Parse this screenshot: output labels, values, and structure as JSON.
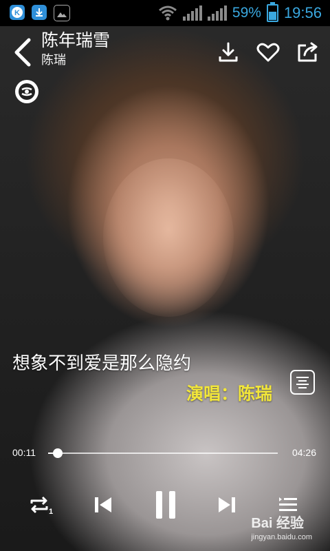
{
  "status_bar": {
    "battery_percent": "59%",
    "time": "19:56",
    "icons": [
      "kugou-app-icon",
      "download-notification-icon",
      "image-notification-icon",
      "wifi-icon",
      "signal-icon",
      "signal-icon",
      "battery-icon"
    ]
  },
  "header": {
    "song_title": "陈年瑞雪",
    "artist": "陈瑞",
    "icons": [
      "back-icon",
      "download-icon",
      "heart-icon",
      "share-icon"
    ]
  },
  "mode_icon": "sound-effect-icon",
  "lyrics": {
    "current_line": "想象不到爱是那么隐约",
    "singer_line": "演唱：陈瑞"
  },
  "progress": {
    "current_time": "00:11",
    "total_time": "04:26",
    "fraction": 0.041
  },
  "controls": {
    "icons": [
      "repeat-one-icon",
      "previous-icon",
      "pause-icon",
      "next-icon",
      "playlist-icon"
    ]
  },
  "watermark": {
    "brand": "Bai 经验",
    "url": "jingyan.baidu.com"
  },
  "colors": {
    "accent": "#3aa8e0",
    "lyric_highlight": "#f2e63a"
  }
}
